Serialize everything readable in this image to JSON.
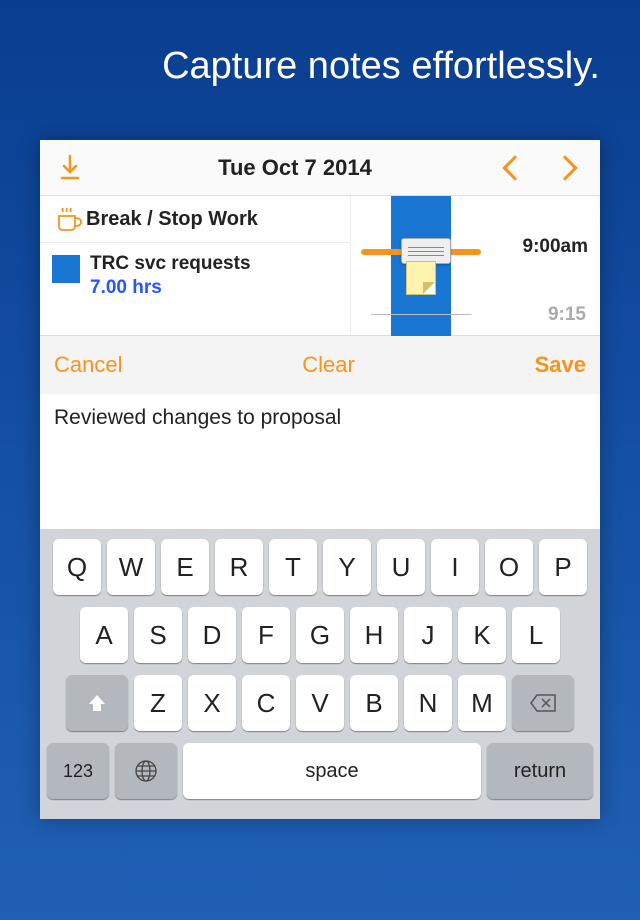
{
  "promo": {
    "heading": "Capture notes effortlessly."
  },
  "topbar": {
    "date": "Tue Oct 7 2014"
  },
  "tasks": {
    "break": "Break / Stop Work",
    "trc": {
      "title": "TRC svc requests",
      "hours": "7.00 hrs"
    }
  },
  "timeline": {
    "t1": "9:00am",
    "t2": "9:15"
  },
  "actions": {
    "cancel": "Cancel",
    "clear": "Clear",
    "save": "Save"
  },
  "note": {
    "text": "Reviewed changes to proposal"
  },
  "keyboard": {
    "row1": [
      "Q",
      "W",
      "E",
      "R",
      "T",
      "Y",
      "U",
      "I",
      "O",
      "P"
    ],
    "row2": [
      "A",
      "S",
      "D",
      "F",
      "G",
      "H",
      "J",
      "K",
      "L"
    ],
    "row3": [
      "Z",
      "X",
      "C",
      "V",
      "B",
      "N",
      "M"
    ],
    "sym": "123",
    "space": "space",
    "return": "return"
  }
}
